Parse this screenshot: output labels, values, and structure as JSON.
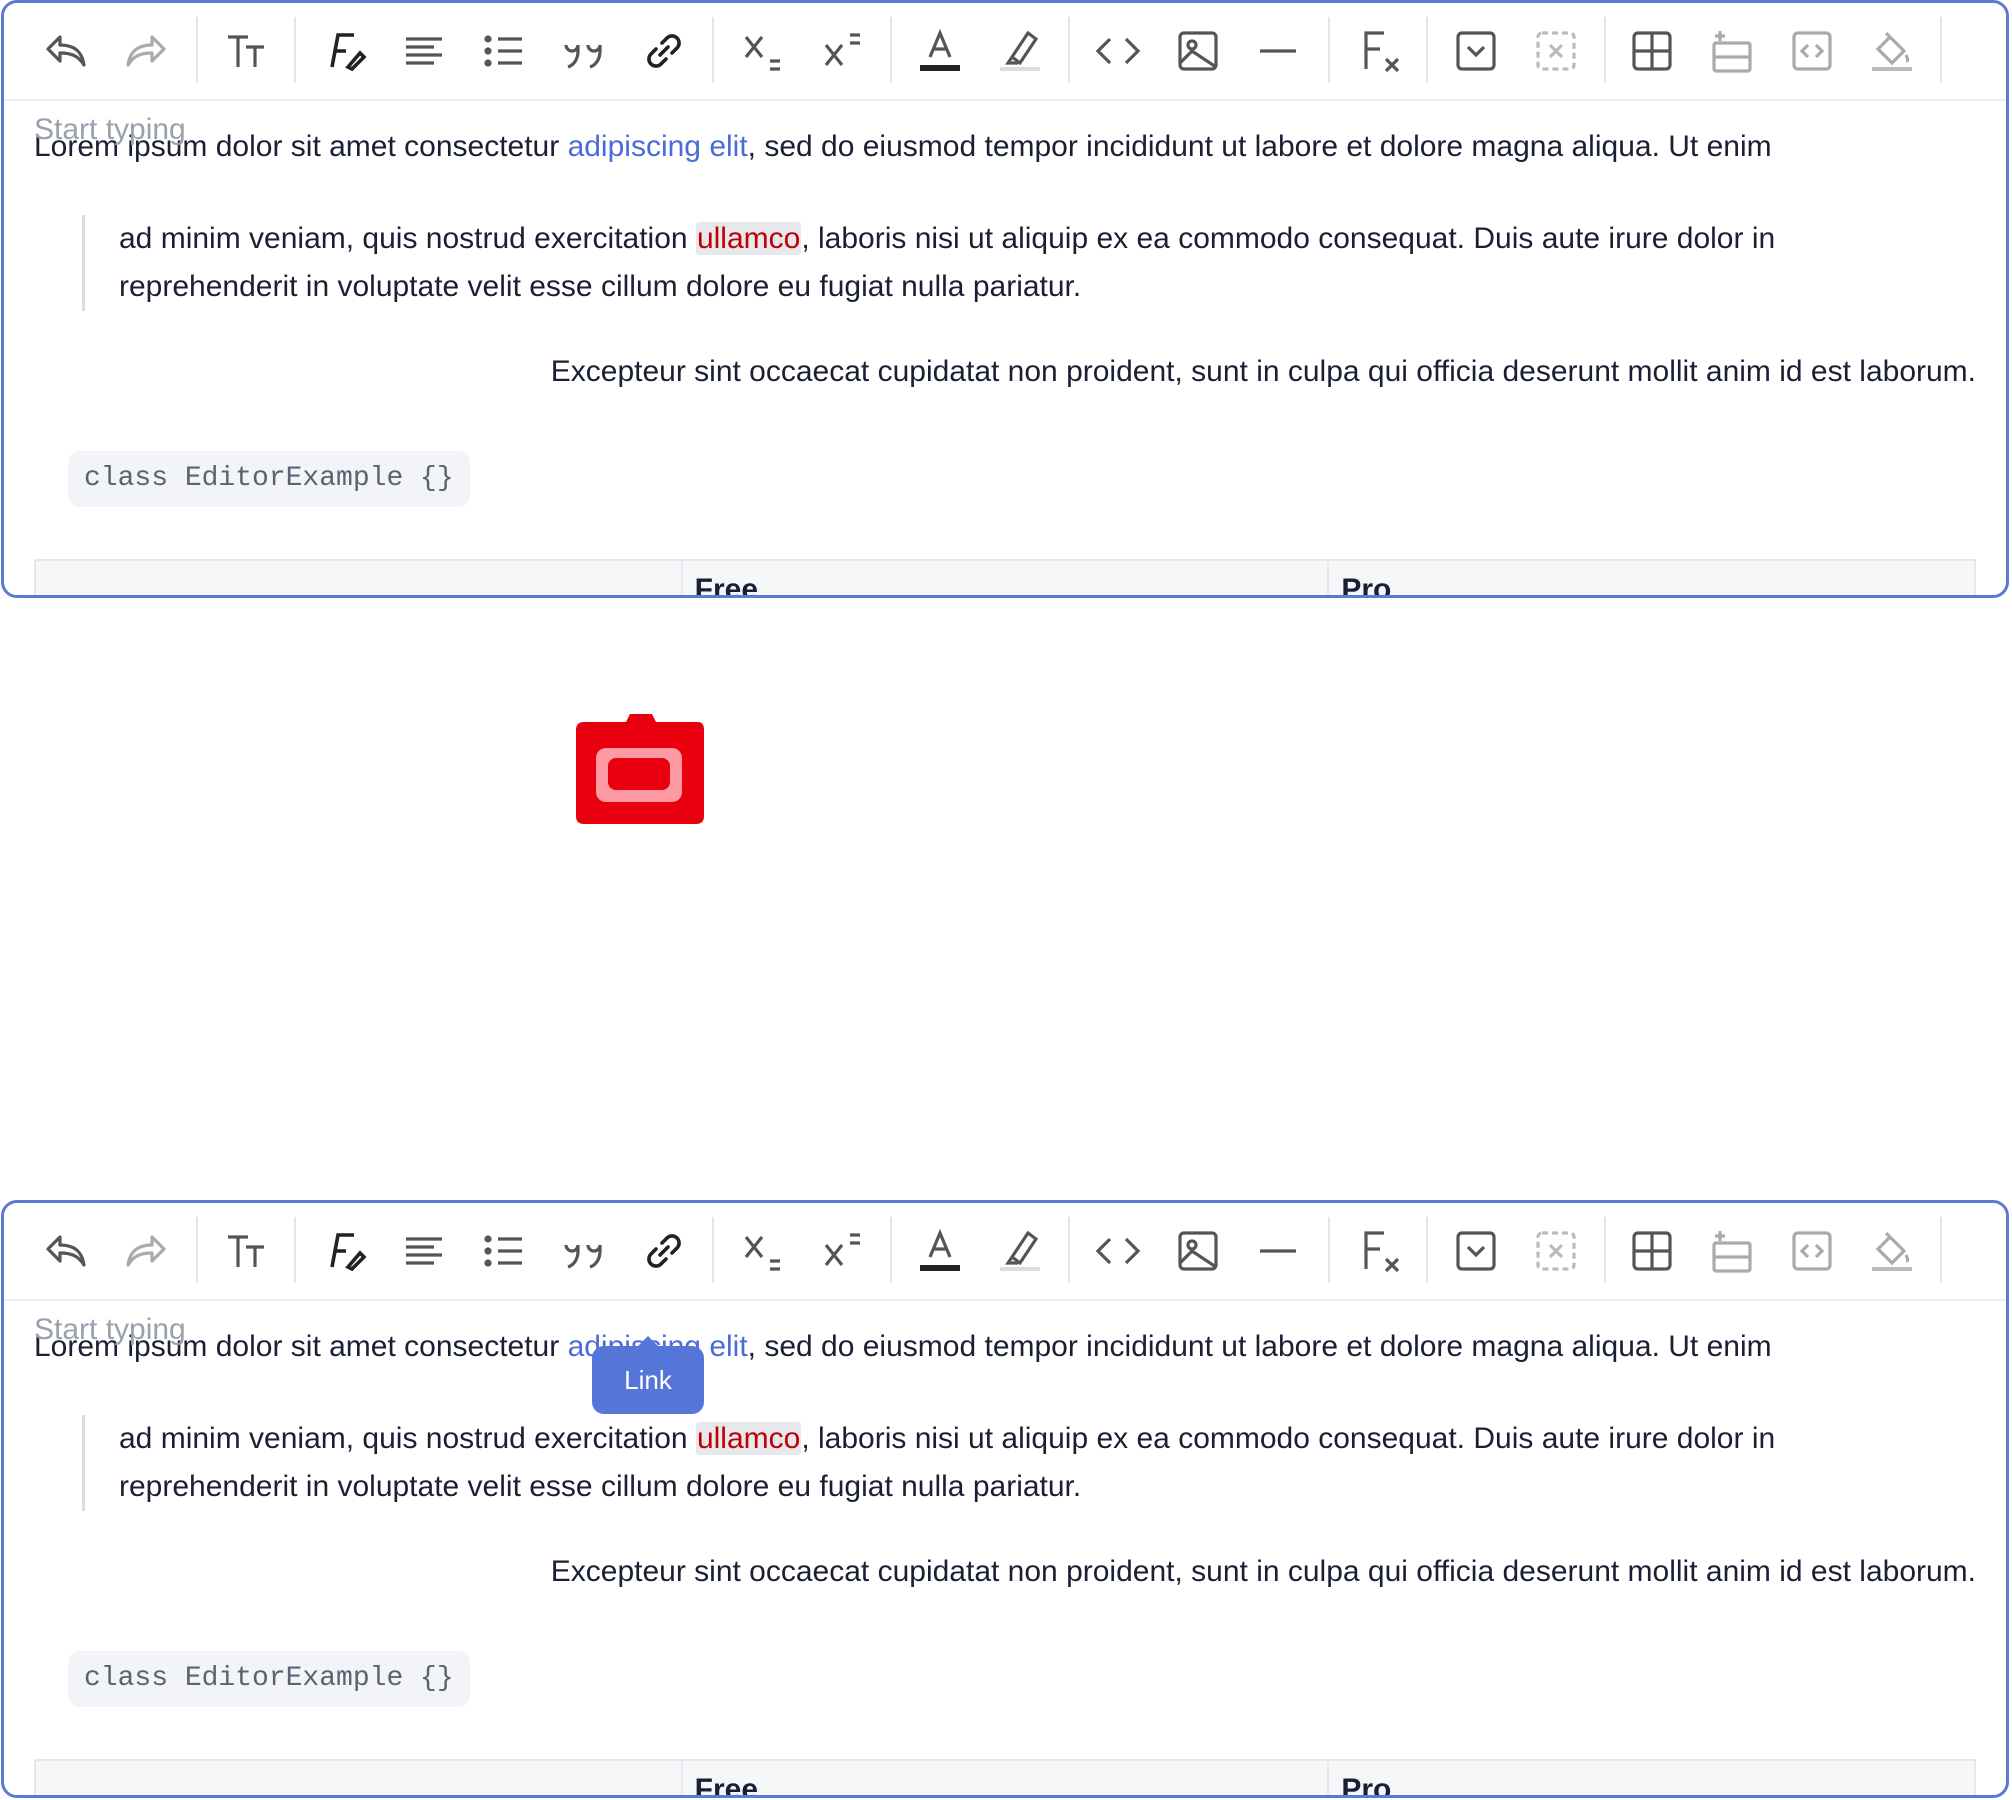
{
  "editor": {
    "placeholder": "Start typing",
    "line1": {
      "before": "Lorem ipsum dolor sit amet consectetur ",
      "link": "adipiscing elit",
      "after": ", sed do eiusmod tempor incididunt ut labore et dolore magna aliqua. Ut enim"
    },
    "quote": {
      "line1_before": "ad minim veniam, quis nostrud exercitation ",
      "highlight": "ullamco",
      "line1_after": ", laboris nisi ut aliquip ex ea commodo consequat. Duis aute irure dolor in",
      "line2": "reprehenderit in voluptate velit esse cillum dolore eu fugiat nulla pariatur."
    },
    "right_paragraph": "Excepteur sint occaecat cupidatat non proident, sunt in culpa qui officia deserunt mollit anim id est laborum.",
    "code": "class EditorExample {}",
    "table_headers": [
      "",
      "Free",
      "Pro"
    ]
  },
  "toolbar": {
    "icons": [
      "undo-icon",
      "redo-icon",
      "text-size-icon",
      "font-style-icon",
      "align-icon",
      "list-icon",
      "quote-icon",
      "link-icon",
      "subscript-icon",
      "superscript-icon",
      "text-color-icon",
      "highlight-icon",
      "code-icon",
      "image-icon",
      "horizontal-rule-icon",
      "clear-format-icon",
      "details-icon",
      "unset-icon",
      "table-icon",
      "insert-row-icon",
      "embed-icon",
      "paint-bucket-icon"
    ]
  },
  "tooltip": {
    "label": "Link"
  },
  "colors": {
    "accent": "#5575d8",
    "border": "#5b79d0",
    "highlight_text": "#c00000",
    "link": "#4a6bd9"
  }
}
